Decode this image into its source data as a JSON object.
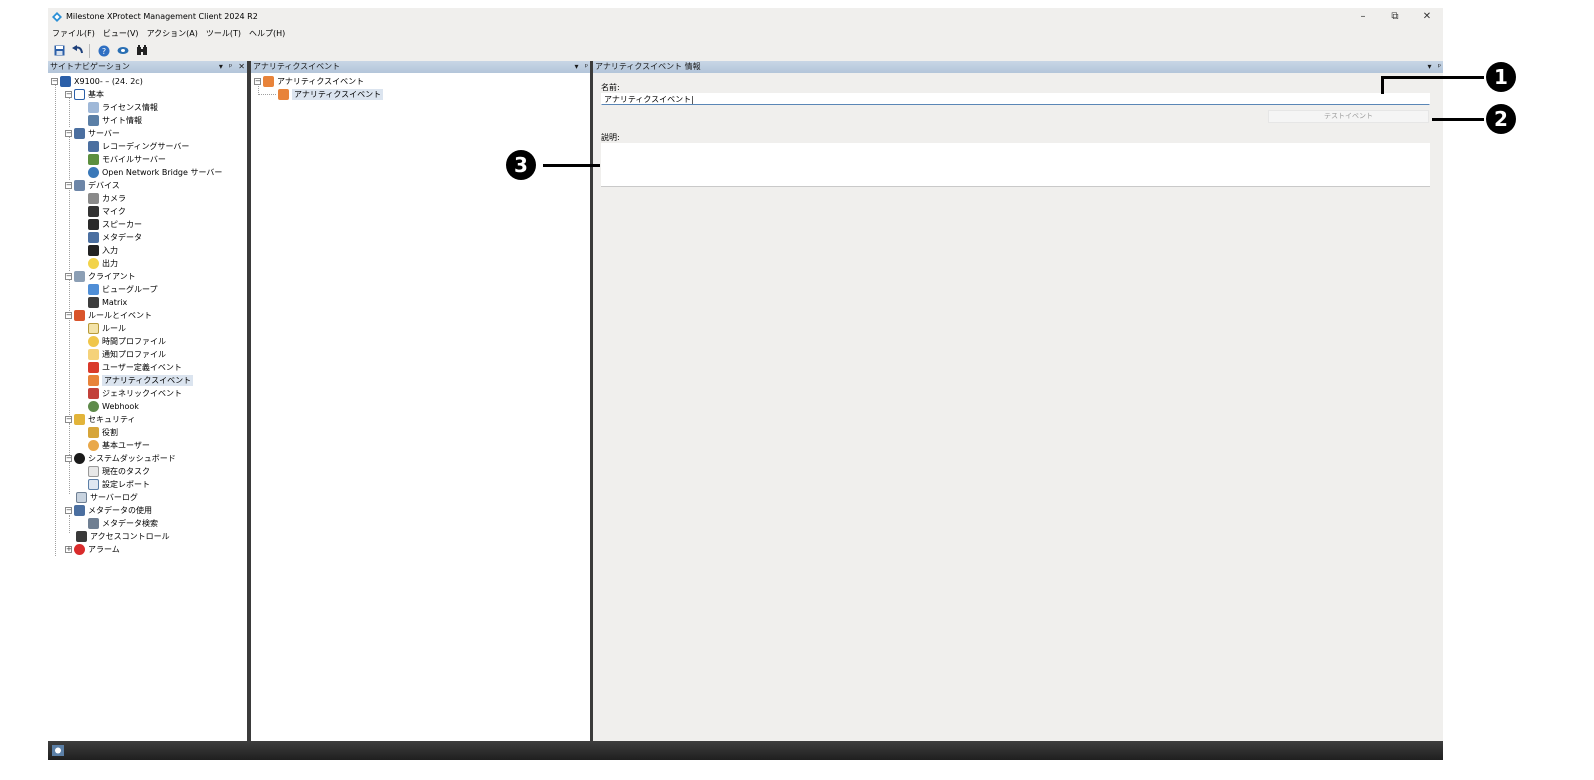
{
  "window": {
    "title": "Milestone XProtect Management Client 2024 R2",
    "controls": {
      "minimize": "–",
      "restore": "⧉",
      "close": "✕"
    }
  },
  "menubar": [
    "ファイル(F)",
    "ビュー(V)",
    "アクション(A)",
    "ツール(T)",
    "ヘルプ(H)"
  ],
  "toolbar": [
    "save-icon",
    "undo-icon",
    "help-icon",
    "connect-icon",
    "search-icon"
  ],
  "site_nav": {
    "header": "サイトナビゲーション",
    "controls": [
      "▾",
      "ᵖ",
      "✕"
    ],
    "root": "X9100-        – (24. 2c)",
    "nodes": {
      "basic": "基本",
      "license": "ライセンス情報",
      "site_info": "サイト情報",
      "servers": "サーバー",
      "recording": "レコーディングサーバー",
      "mobile": "モバイルサーバー",
      "onb": "Open Network Bridge サーバー",
      "devices": "デバイス",
      "cameras": "カメラ",
      "mic": "マイク",
      "speaker": "スピーカー",
      "metadata": "メタデータ",
      "input": "入力",
      "output": "出力",
      "clients": "クライアント",
      "view_groups": "ビューグループ",
      "matrix": "Matrix",
      "rules_events": "ルールとイベント",
      "rules": "ルール",
      "time_profiles": "時間プロファイル",
      "notify_profiles": "通知プロファイル",
      "user_events": "ユーザー定義イベント",
      "analytics_events": "アナリティクスイベント",
      "generic_events": "ジェネリックイベント",
      "webhook": "Webhook",
      "security": "セキュリティ",
      "roles": "役割",
      "basic_users": "基本ユーザー",
      "dashboard": "システムダッシュボード",
      "current_tasks": "現在のタスク",
      "config_reports": "設定レポート",
      "server_logs": "サーバーログ",
      "metadata_use": "メタデータの使用",
      "metadata_search": "メタデータ検索",
      "access_control": "アクセスコントロール",
      "alarms": "アラーム"
    }
  },
  "overview": {
    "header": "アナリティクスイベント",
    "controls": [
      "▾",
      "ᵖ"
    ],
    "root": "アナリティクスイベント",
    "child": "アナリティクスイベント"
  },
  "properties": {
    "header": "アナリティクスイベント 情報",
    "controls": [
      "▾",
      "ᵖ"
    ],
    "name_label": "名前:",
    "name_value": "アナリティクスイベント|",
    "test_button": "テストイベント",
    "description_label": "説明:",
    "description_value": ""
  },
  "callouts": [
    "1",
    "2",
    "3"
  ]
}
